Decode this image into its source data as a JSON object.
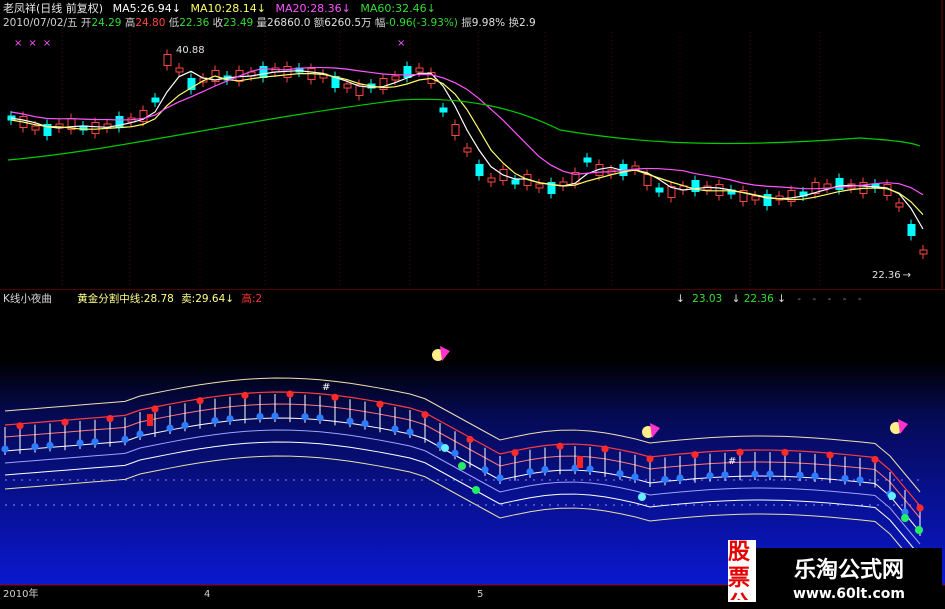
{
  "colors": {
    "background": "#000000",
    "up": "#ff4444",
    "down": "#00ffff",
    "ma5": "#ffffff",
    "ma10": "#ffff66",
    "ma20": "#ff55ff",
    "ma60": "#00cc00",
    "text": "#c8c8c8",
    "lower_bg": "#0a14c8",
    "watermark_red": "#e60000"
  },
  "header": {
    "title": "老凤祥(日线 前复权)",
    "ma5": "MA5:26.94↓",
    "ma10": "MA10:28.14↓",
    "ma20": "MA20:28.36↓",
    "ma60": "MA60:32.46↓",
    "date": "2010/07/02/五",
    "open_label": "开",
    "open": "24.29",
    "high_label": "高",
    "high": "24.80",
    "low_label": "低",
    "low": "22.36",
    "close_label": "收",
    "close": "23.49",
    "vol_label": "量",
    "vol": "26860.0",
    "amt_label": "额",
    "amt": "6260.5万",
    "chg_label": "幅",
    "chg": "-0.96(-3.93%)",
    "amp_label": "振",
    "amp": "9.98%",
    "turn_label": "换",
    "turn": "2.9"
  },
  "upper": {
    "hi_label": "40.88",
    "lo_label": "22.36",
    "lo_arrow": "→",
    "star_marker": "×"
  },
  "indicator": {
    "name": "K线小夜曲",
    "golden": "黄金分割中线:28.78",
    "sell": "卖:29.64",
    "sell_arrow": "↓",
    "high_lbl": "高:2",
    "r_val1": "23.03",
    "r_val2": "22.36",
    "r_arrow": "↓",
    "marker": "#"
  },
  "axis": {
    "year": "2010年",
    "m4": "4",
    "m5": "5"
  },
  "watermark": {
    "left": "股票公式指标网",
    "brand": "乐淘公式网",
    "url": "www.60lt.com"
  }
}
